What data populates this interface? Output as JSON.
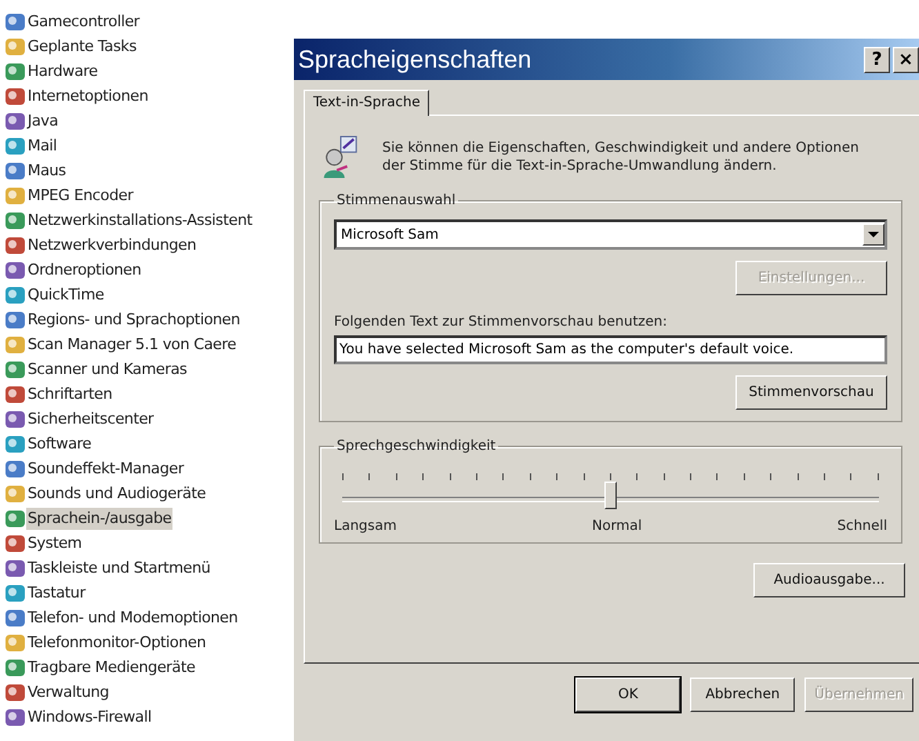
{
  "control_panel": {
    "items": [
      {
        "label": "Gamecontroller",
        "selected": false
      },
      {
        "label": "Geplante Tasks",
        "selected": false
      },
      {
        "label": "Hardware",
        "selected": false
      },
      {
        "label": "Internetoptionen",
        "selected": false
      },
      {
        "label": "Java",
        "selected": false
      },
      {
        "label": "Mail",
        "selected": false
      },
      {
        "label": "Maus",
        "selected": false
      },
      {
        "label": "MPEG Encoder",
        "selected": false
      },
      {
        "label": "Netzwerkinstallations-Assistent",
        "selected": false
      },
      {
        "label": "Netzwerkverbindungen",
        "selected": false
      },
      {
        "label": "Ordneroptionen",
        "selected": false
      },
      {
        "label": "QuickTime",
        "selected": false
      },
      {
        "label": "Regions- und Sprachoptionen",
        "selected": false
      },
      {
        "label": "Scan Manager 5.1 von Caere",
        "selected": false
      },
      {
        "label": "Scanner und Kameras",
        "selected": false
      },
      {
        "label": "Schriftarten",
        "selected": false
      },
      {
        "label": "Sicherheitscenter",
        "selected": false
      },
      {
        "label": "Software",
        "selected": false
      },
      {
        "label": "Soundeffekt-Manager",
        "selected": false
      },
      {
        "label": "Sounds und Audiogeräte",
        "selected": false
      },
      {
        "label": "Sprachein-/ausgabe",
        "selected": true
      },
      {
        "label": "System",
        "selected": false
      },
      {
        "label": "Taskleiste und Startmenü",
        "selected": false
      },
      {
        "label": "Tastatur",
        "selected": false
      },
      {
        "label": "Telefon- und Modemoptionen",
        "selected": false
      },
      {
        "label": "Telefonmonitor-Optionen",
        "selected": false
      },
      {
        "label": "Tragbare Mediengeräte",
        "selected": false
      },
      {
        "label": "Verwaltung",
        "selected": false
      },
      {
        "label": "Windows-Firewall",
        "selected": false
      }
    ]
  },
  "window": {
    "title": "Spracheigenschaften",
    "title_buttons": [
      "?",
      "×"
    ]
  },
  "tabs": [
    {
      "label": "Text-in-Sprache",
      "selected": true
    }
  ],
  "intro": "Sie können die Eigenschaften, Geschwindigkeit und andere Optionen der Stimme für die Text-in-Sprache-Umwandlung ändern.",
  "voice_group": {
    "legend": "Stimmenauswahl",
    "voice": "Microsoft Sam",
    "settings_button": {
      "label": "Einstellungen...",
      "disabled": true
    },
    "preview_label": "Folgenden Text zur Stimmenvorschau benutzen:",
    "preview_text": "You have selected Microsoft Sam as the computer's default voice.",
    "preview_button": {
      "label": "Stimmenvorschau",
      "disabled": false
    }
  },
  "speed_group": {
    "legend": "Sprechgeschwindigkeit",
    "level": 0.5,
    "min_label": "Langsam",
    "mid_label": "Normal",
    "max_label": "Schnell"
  },
  "audio_button": {
    "label": "Audioausgabe...",
    "disabled": false
  },
  "buttons": [
    {
      "label": "OK",
      "disabled": false,
      "default": true
    },
    {
      "label": "Abbrechen",
      "disabled": false,
      "default": false
    },
    {
      "label": "Übernehmen",
      "disabled": true,
      "default": false
    }
  ]
}
